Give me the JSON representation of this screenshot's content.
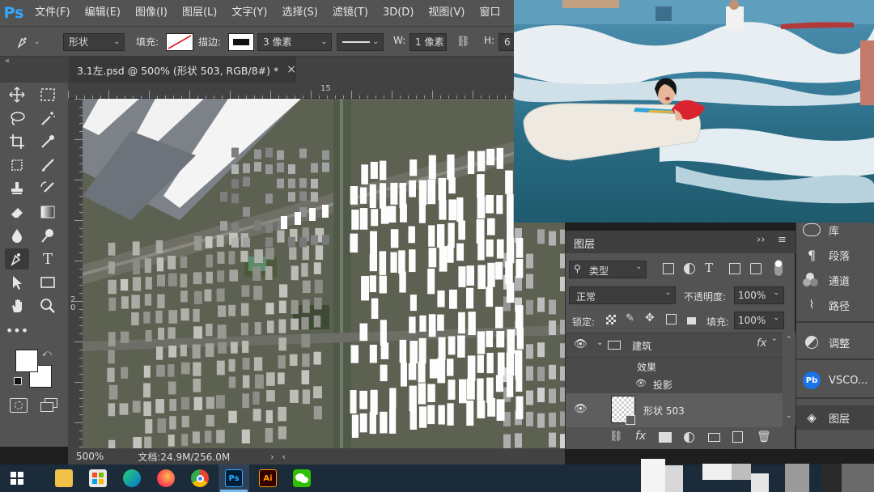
{
  "menu": {
    "logo": "Ps",
    "items": [
      "文件(F)",
      "编辑(E)",
      "图像(I)",
      "图层(L)",
      "文字(Y)",
      "选择(S)",
      "滤镜(T)",
      "3D(D)",
      "视图(V)",
      "窗口"
    ]
  },
  "options": {
    "mode": "形状",
    "fill_label": "填充:",
    "stroke_label": "描边:",
    "stroke_width": "3 像素",
    "w_label": "W:",
    "w_value": "1 像素",
    "h_label": "H:",
    "h_value": "6"
  },
  "document": {
    "tab_title": "3.1左.psd @ 500% (形状 503, RGB/8#) *",
    "close": "×",
    "ruler_top_label": "15",
    "ruler_left_label": "2 0",
    "zoom": "500%",
    "doc_size": "文档:24.9M/256.0M"
  },
  "layers_panel": {
    "title": "图层",
    "filter_kind": "类型",
    "blend_mode": "正常",
    "opacity_label": "不透明度:",
    "opacity_value": "100%",
    "lock_label": "锁定:",
    "fill_label": "填充:",
    "fill_value": "100%",
    "layers": [
      {
        "name": "建筑",
        "type": "group",
        "fx": "fx"
      },
      {
        "name": "效果",
        "type": "effects"
      },
      {
        "name": "投影",
        "type": "effect"
      },
      {
        "name": "形状 503",
        "type": "shape"
      }
    ],
    "bottom_icons": [
      "link-icon",
      "fx-icon",
      "mask-icon",
      "adjustment-icon",
      "folder-icon",
      "new-layer-icon",
      "trash-icon"
    ]
  },
  "dock": {
    "items": [
      {
        "label": "库",
        "icon": "library-icon"
      },
      {
        "label": "段落",
        "icon": "paragraph-icon"
      },
      {
        "label": "通道",
        "icon": "channels-icon"
      },
      {
        "label": "路径",
        "icon": "paths-icon"
      },
      {
        "label": "调整",
        "icon": "adjustments-icon"
      },
      {
        "label": "VSCO...",
        "icon": "vsco-icon"
      },
      {
        "label": "图层",
        "icon": "layers-icon"
      }
    ]
  },
  "taskbar": {
    "icons": [
      "windows-start-icon",
      "file-explorer-icon",
      "store-icon",
      "edge-icon",
      "firefox-icon",
      "chrome-icon",
      "photoshop-icon",
      "illustrator-icon",
      "wechat-icon"
    ],
    "ps_label": "Ps",
    "ai_label": "Ai"
  },
  "colors": {
    "ui_bg": "#535353",
    "ui_dark": "#424242",
    "ps_blue": "#31a8ff",
    "ai_orange": "#ff9a00",
    "taskbar": "#1c2b3a"
  }
}
